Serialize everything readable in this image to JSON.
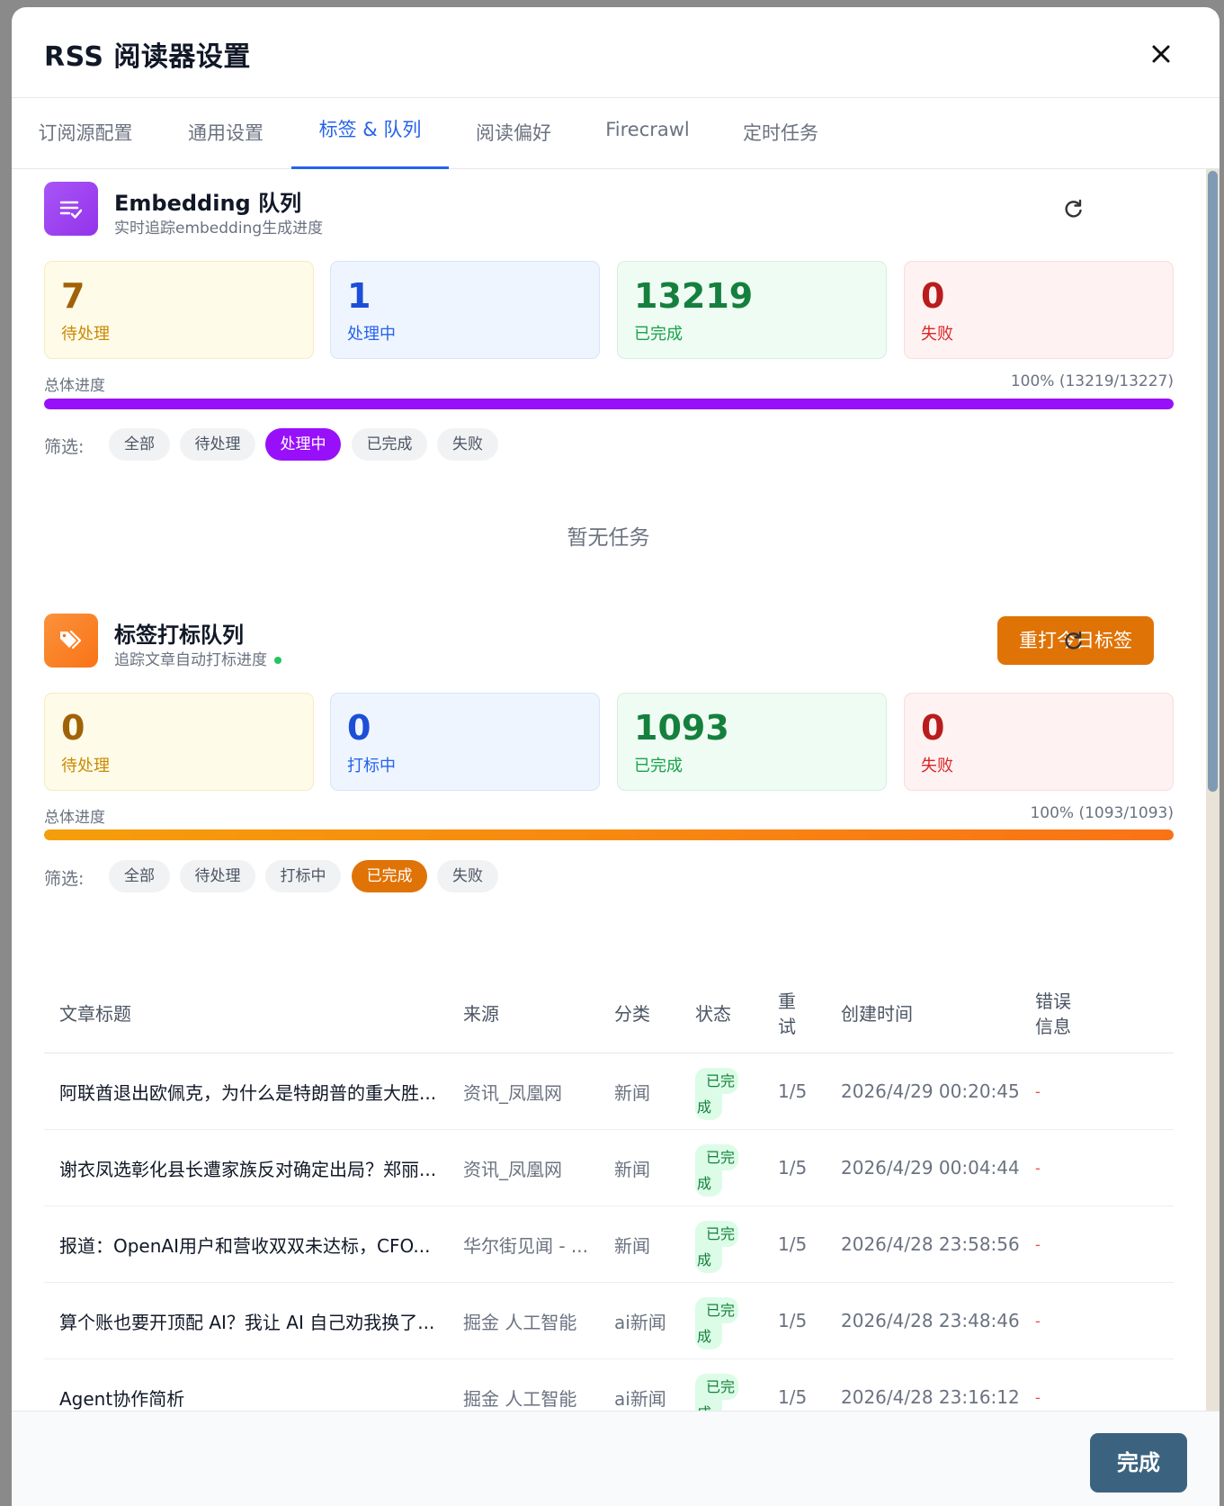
{
  "modal": {
    "title": "RSS 阅读器设置"
  },
  "tabs": [
    {
      "label": "订阅源配置"
    },
    {
      "label": "通用设置"
    },
    {
      "label": "标签 & 队列"
    },
    {
      "label": "阅读偏好"
    },
    {
      "label": "Firecrawl"
    },
    {
      "label": "定时任务"
    }
  ],
  "active_tab": "标签 & 队列",
  "embedding": {
    "title": "Embedding 队列",
    "subtitle": "实时追踪embedding生成进度",
    "stats": [
      {
        "value": "7",
        "label": "待处理"
      },
      {
        "value": "1",
        "label": "处理中"
      },
      {
        "value": "13219",
        "label": "已完成"
      },
      {
        "value": "0",
        "label": "失败"
      }
    ],
    "progress_label": "总体进度",
    "progress_text": "100% (13219/13227)",
    "progress_fraction": 1.0,
    "filter_label": "筛选:",
    "filters": [
      "全部",
      "待处理",
      "处理中",
      "已完成",
      "失败"
    ],
    "active_filter": "处理中",
    "empty_text": "暂无任务",
    "accent": "#9810fa"
  },
  "tagging": {
    "title": "标签打标队列",
    "subtitle": "追踪文章自动打标进度",
    "retag_button": "重打今日标签",
    "stats": [
      {
        "value": "0",
        "label": "待处理"
      },
      {
        "value": "0",
        "label": "打标中"
      },
      {
        "value": "1093",
        "label": "已完成"
      },
      {
        "value": "0",
        "label": "失败"
      }
    ],
    "progress_label": "总体进度",
    "progress_text": "100% (1093/1093)",
    "progress_fraction": 1.0,
    "filter_label": "筛选:",
    "filters": [
      "全部",
      "待处理",
      "打标中",
      "已完成",
      "失败"
    ],
    "active_filter": "已完成",
    "accent": "#e07306"
  },
  "table": {
    "headers": {
      "title": "文章标题",
      "source": "来源",
      "category": "分类",
      "status": "状态",
      "retry": "重试",
      "created": "创建时间",
      "error": "错误信息"
    },
    "rows": [
      {
        "title": "阿联酋退出欧佩克，为什么是特朗普的重大胜...",
        "source": "资讯_凤凰网",
        "category": "新闻",
        "status": "已完成",
        "retry": "1/5",
        "created": "2026/4/29 00:20:45",
        "error": "-"
      },
      {
        "title": "谢衣凤选彰化县长遭家族反对确定出局？郑丽...",
        "source": "资讯_凤凰网",
        "category": "新闻",
        "status": "已完成",
        "retry": "1/5",
        "created": "2026/4/29 00:04:44",
        "error": "-"
      },
      {
        "title": "报道：OpenAI用户和营收双双未达标，CFO...",
        "source": "华尔街见闻 - ...",
        "category": "新闻",
        "status": "已完成",
        "retry": "1/5",
        "created": "2026/4/28 23:58:56",
        "error": "-"
      },
      {
        "title": "算个账也要开顶配 AI？我让 AI 自己劝我换了...",
        "source": "掘金 人工智能",
        "category": "ai新闻",
        "status": "已完成",
        "retry": "1/5",
        "created": "2026/4/28 23:48:46",
        "error": "-"
      },
      {
        "title": "Agent协作简析",
        "source": "掘金 人工智能",
        "category": "ai新闻",
        "status": "已完成",
        "retry": "1/5",
        "created": "2026/4/28 23:16:12",
        "error": "-"
      }
    ]
  },
  "footer": {
    "done_button": "完成"
  },
  "colors": {
    "primary_blue": "#2563eb",
    "done_button": "#3b6380"
  }
}
